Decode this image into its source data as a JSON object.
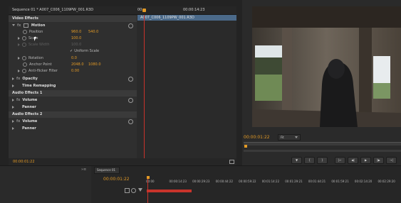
{
  "effect_controls": {
    "sequence_tab": "Sequence 01 * A007_C006_1109PW_001.R3D",
    "clip_label": "A007_C006_1109PW_001.R3D",
    "ruler_start": "00:",
    "ruler_time": "00:00:14:23",
    "sections": {
      "video_effects": "Video Effects",
      "motion": "Motion",
      "opacity": "Opacity",
      "time_remapping": "Time Remapping",
      "audio_effects_1": "Audio Effects 1",
      "audio_effects_2": "Audio Effects 2",
      "volume": "Volume",
      "panner": "Panner"
    },
    "properties": {
      "position_label": "Position",
      "position_x": "960.0",
      "position_y": "540.0",
      "scale_label": "Scale",
      "scale_value": "100.0",
      "scale_width_label": "Scale Width",
      "scale_width_value": "100.0",
      "uniform_scale_label": "Uniform Scale",
      "rotation_label": "Rotation",
      "rotation_value": "0.0",
      "anchor_label": "Anchor Point",
      "anchor_x": "2048.0",
      "anchor_y": "1080.0",
      "flicker_label": "Anti-flicker Filter",
      "flicker_value": "0.00"
    },
    "footer_time": "00:00:01:22"
  },
  "program_monitor": {
    "timecode": "00:00:01:22",
    "zoom": "Fit"
  },
  "timeline": {
    "tab": "Sequence 01",
    "timecode": "00:00:01:22",
    "ruler_labels": [
      "00:00",
      "00:00:14:23",
      "00:00:29:23",
      "00:00:44:22",
      "00:00:59:22",
      "00:01:14:22",
      "00:01:29:21",
      "00:01:44:21",
      "00:01:59:21",
      "00:02:14:20",
      "00:02:29:20"
    ]
  },
  "colors": {
    "timecode": "#e39a25",
    "playhead": "#c8332b",
    "clip_selected": "#4b6a8a"
  }
}
